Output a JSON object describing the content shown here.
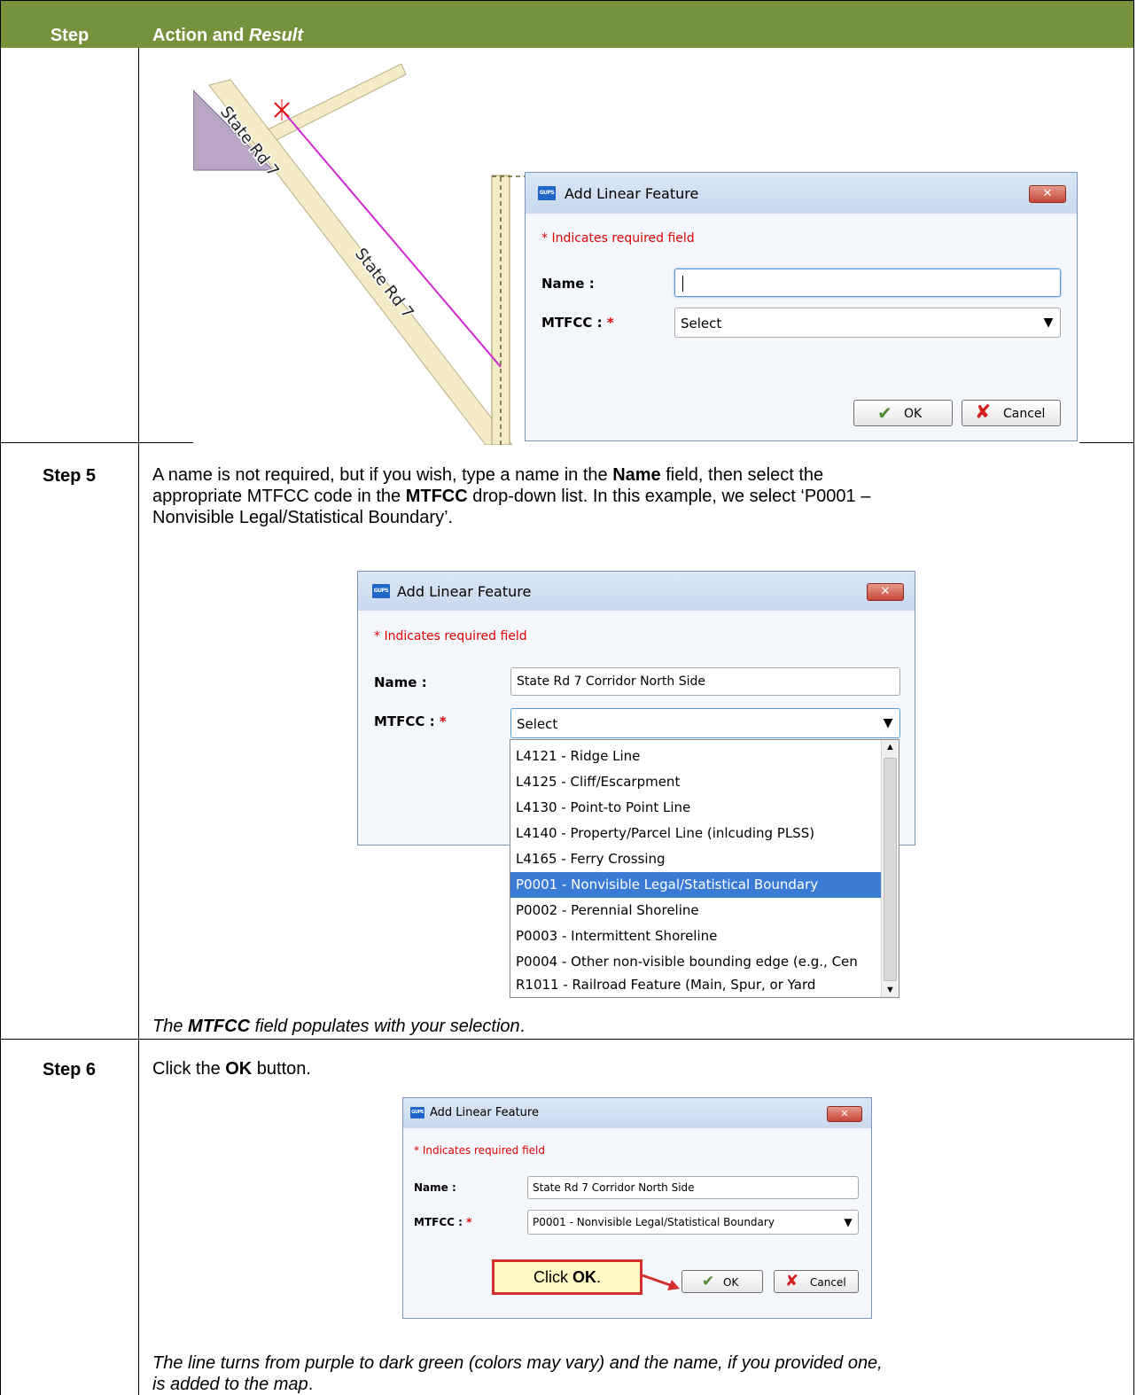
{
  "header": {
    "col_step": "Step",
    "col_action_prefix": "Action and ",
    "col_action_italic": "Result"
  },
  "map": {
    "road_label_1": "State Rd 7",
    "road_label_2": "State Rd 7"
  },
  "dialog1": {
    "icon_text": "GUPS",
    "title": "Add Linear Feature",
    "required_note": "* Indicates required field",
    "name_label": "Name :",
    "name_value": "",
    "mtfcc_label": "MTFCC :",
    "mtfcc_star": "*",
    "mtfcc_value": "Select",
    "ok_label": "OK",
    "cancel_label": "Cancel"
  },
  "step5": {
    "label": "Step 5",
    "text_a": "A name is not required, but if you wish, type a name in the ",
    "text_b": "Name",
    "text_c": " field, then select the",
    "line2_a": "appropriate MTFCC code in the ",
    "line2_b": "MTFCC",
    "line2_c": " drop-down list. In this example, we select ‘P0001 –",
    "line3": "Nonvisible Legal/Statistical Boundary’.",
    "result_bold": "MTFCC",
    "result_a": "The ",
    "result_c": " field populates with your selection",
    "result_d": "."
  },
  "dialog2": {
    "icon_text": "GUPS",
    "title": "Add Linear Feature",
    "required_note": "* Indicates required field",
    "name_label": "Name :",
    "name_value": "State Rd 7 Corridor North Side",
    "mtfcc_label": "MTFCC :",
    "mtfcc_star": "*",
    "mtfcc_value": "Select",
    "options": [
      "L4121 - Ridge Line",
      "L4125 - Cliff/Escarpment",
      "L4130 - Point-to Point Line",
      "L4140 - Property/Parcel Line (inlcuding PLSS)",
      "L4165 - Ferry Crossing",
      "P0001 - Nonvisible Legal/Statistical Boundary",
      "P0002 - Perennial Shoreline",
      "P0003 - Intermittent Shoreline",
      "P0004 - Other non-visible bounding edge (e.g., Cen",
      "R1011 - Railroad Feature (Main, Spur, or Yard"
    ]
  },
  "step6": {
    "label": "Step 6",
    "text_a": "Click the ",
    "text_b": "OK",
    "text_c": " button.",
    "result_line1": "The line turns from purple to dark green (colors may vary) and the name, if you provided one,",
    "result_line2_a": "is added to the map",
    "result_line2_b": "."
  },
  "dialog3": {
    "icon_text": "GUPS",
    "title": "Add Linear Feature",
    "required_note": "* Indicates required field",
    "name_label": "Name :",
    "name_value": "State Rd 7 Corridor North Side",
    "mtfcc_label": "MTFCC :",
    "mtfcc_star": "*",
    "mtfcc_value": "P0001 - Nonvisible Legal/Statistical Boundary",
    "ok_label": "OK",
    "cancel_label": "Cancel",
    "callout_a": "Click ",
    "callout_b": "OK",
    "callout_c": "."
  }
}
